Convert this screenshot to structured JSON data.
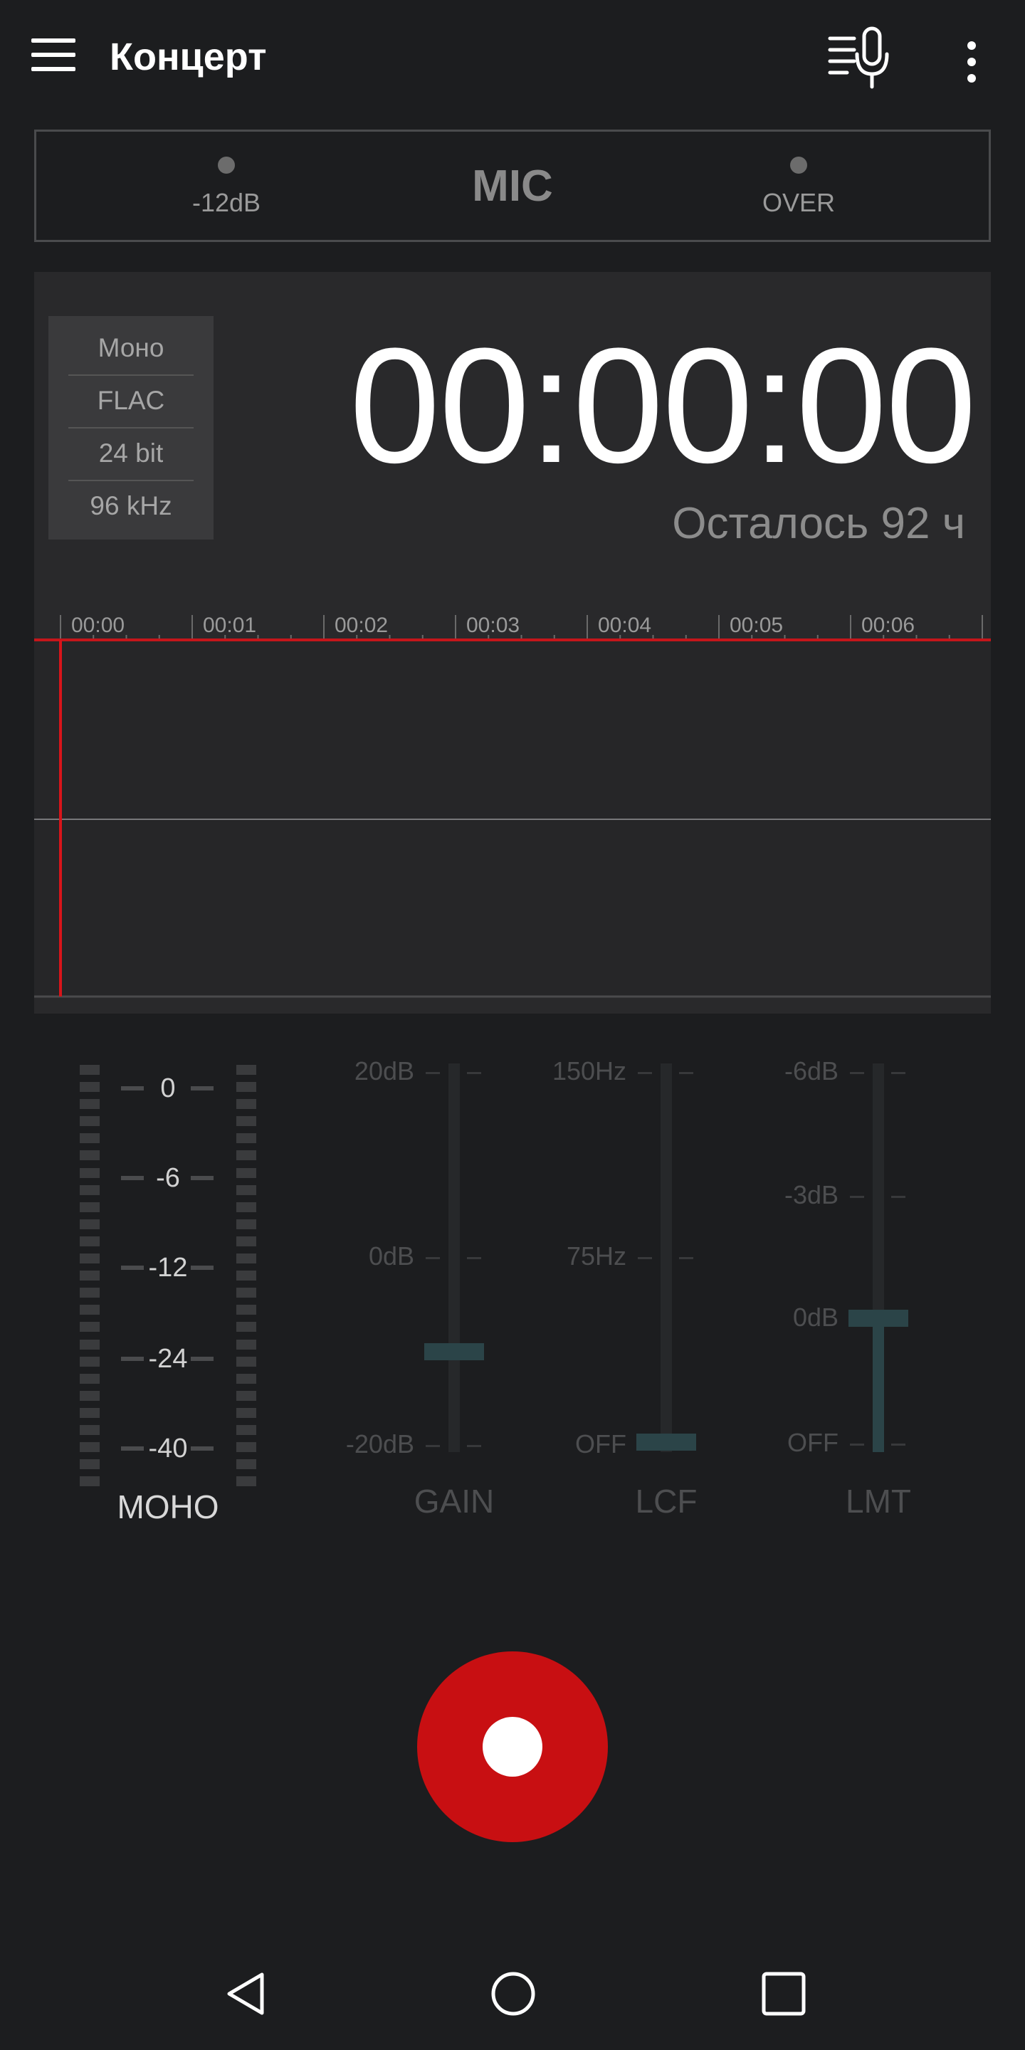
{
  "app_bar": {
    "title": "Концерт",
    "menu_icon": "hamburger-menu-icon",
    "mic_list_icon": "microphone-list-icon",
    "more_icon": "more-vertical-icon"
  },
  "mic_status": {
    "left_indicator_label": "-12dB",
    "source_label": "MIC",
    "right_indicator_label": "OVER"
  },
  "format": {
    "channels": "Моно",
    "codec": "FLAC",
    "bit_depth": "24 bit",
    "sample_rate": "96 kHz"
  },
  "timer": {
    "elapsed": "00:00:00",
    "remaining": "Осталось 92 ч"
  },
  "timeline": {
    "ticks": [
      "00:00",
      "00:01",
      "00:02",
      "00:03",
      "00:04",
      "00:05",
      "00:06"
    ],
    "playhead_color": "#d8141a"
  },
  "level_meter": {
    "scale": [
      "0",
      "-6",
      "-12",
      "-24",
      "-40"
    ],
    "channel_label": "МОНО"
  },
  "sliders": {
    "gain": {
      "name": "GAIN",
      "top": "20dB",
      "mid": "0dB",
      "bottom": "-20dB",
      "value_db": -10
    },
    "lcf": {
      "name": "LCF",
      "top": "150Hz",
      "mid": "75Hz",
      "bottom": "OFF",
      "value": "OFF"
    },
    "lmt": {
      "name": "LMT",
      "top": "-6dB",
      "upper_mid": "-3dB",
      "lower_mid": "0dB",
      "bottom": "OFF",
      "value_db": 0
    }
  },
  "record": {
    "icon": "record-icon",
    "color": "#c80f12"
  },
  "nav": {
    "back_icon": "back-triangle-icon",
    "home_icon": "home-circle-icon",
    "recents_icon": "recents-square-icon"
  }
}
